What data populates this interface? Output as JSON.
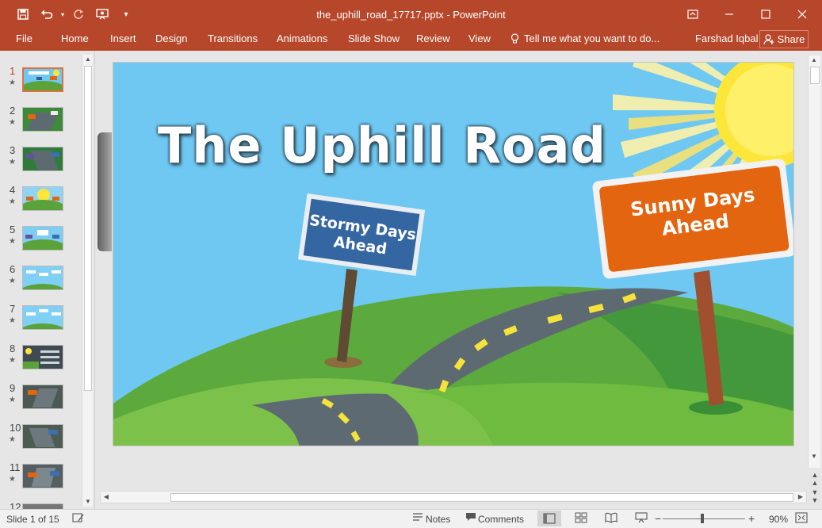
{
  "window": {
    "title": "the_uphill_road_17717.pptx - PowerPoint",
    "accent": "#b7472a",
    "qat_icons": [
      "save-icon",
      "undo-icon",
      "redo-icon",
      "present-icon",
      "customize-icon"
    ],
    "qat_glyphs": [
      "🖫",
      "↶",
      "↻",
      "⊙",
      "▾"
    ],
    "controls": {
      "ribbon_display": "⊡",
      "minimize": "—",
      "maximize": "☐",
      "close": "✕"
    }
  },
  "ribbon": {
    "tabs": [
      "File",
      "Home",
      "Insert",
      "Design",
      "Transitions",
      "Animations",
      "Slide Show",
      "Review",
      "View"
    ],
    "tell_me": "Tell me what you want to do...",
    "user": "Farshad Iqbal",
    "share": "Share"
  },
  "thumbnails": {
    "numbers": [
      "1",
      "2",
      "3",
      "4",
      "5",
      "6",
      "7",
      "8",
      "9",
      "10",
      "11",
      "12"
    ],
    "star": "★",
    "active_index": 0
  },
  "slide": {
    "title": "The Uphill Road",
    "sign_left": {
      "line1": "Stormy Days",
      "line2": "Ahead",
      "color": "#2f5d93"
    },
    "sign_right": {
      "line1": "Sunny Days",
      "line2": "Ahead",
      "color": "#e3650f"
    },
    "colors": {
      "sky": "#6fc8f2",
      "hill": "#5aa23a",
      "road": "#5e6a72",
      "dash": "#f5e23b",
      "sun": "#fde63a"
    }
  },
  "statusbar": {
    "slide_info": "Slide 1 of 15",
    "notes": "Notes",
    "comments": "Comments",
    "zoom": "90%",
    "zoom_level": 0.9
  }
}
